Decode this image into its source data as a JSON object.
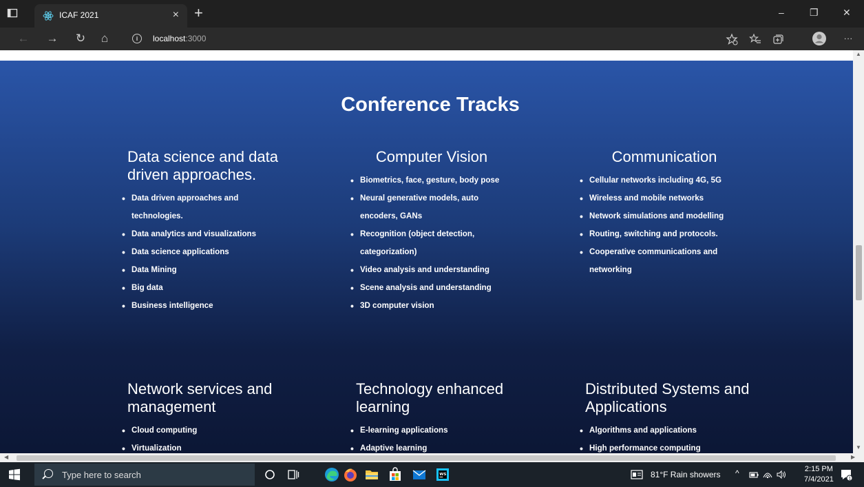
{
  "browser": {
    "tab_title": "ICAF 2021",
    "tab_close": "×",
    "new_tab": "+",
    "url_host": "localhost",
    "url_port": ":3000",
    "controls": {
      "minimize": "–",
      "maximize": "❐",
      "close": "✕"
    },
    "nav": {
      "back": "←",
      "forward": "→",
      "refresh": "↻",
      "home": "⌂",
      "more": "···"
    }
  },
  "page": {
    "heading": "Conference Tracks",
    "tracks": [
      {
        "title": "Data science and data driven approaches.",
        "items": [
          "Data driven approaches and technologies.",
          "Data analytics and visualizations",
          "Data science applications",
          "Data Mining",
          "Big data",
          "Business intelligence"
        ]
      },
      {
        "title": "Computer Vision",
        "items": [
          "Biometrics, face, gesture, body pose",
          "Neural generative models, auto encoders, GANs",
          "Recognition (object detection, categorization)",
          "Video analysis and understanding",
          "Scene analysis and understanding",
          "3D computer vision"
        ]
      },
      {
        "title": "Communication",
        "items": [
          "Cellular networks including 4G, 5G",
          "Wireless and mobile networks",
          "Network simulations and modelling",
          "Routing, switching and protocols.",
          "Cooperative communications and networking"
        ]
      },
      {
        "title": "Network services and management",
        "items": [
          "Cloud computing",
          "Virtualization"
        ]
      },
      {
        "title": "Technology enhanced learning",
        "items": [
          "E-learning applications",
          "Adaptive learning"
        ]
      },
      {
        "title": "Distributed Systems and Applications",
        "items": [
          "Algorithms and applications",
          "High performance computing"
        ]
      }
    ]
  },
  "taskbar": {
    "search_placeholder": "Type here to search",
    "weather": "81°F  Rain showers",
    "time": "2:15 PM",
    "date": "7/4/2021",
    "tray_chevron": "^"
  },
  "colors": {
    "page_gradient_top": "#2a55a8",
    "page_gradient_bottom": "#0b1532",
    "taskbar": "#1b2229",
    "browser_chrome": "#202020"
  }
}
